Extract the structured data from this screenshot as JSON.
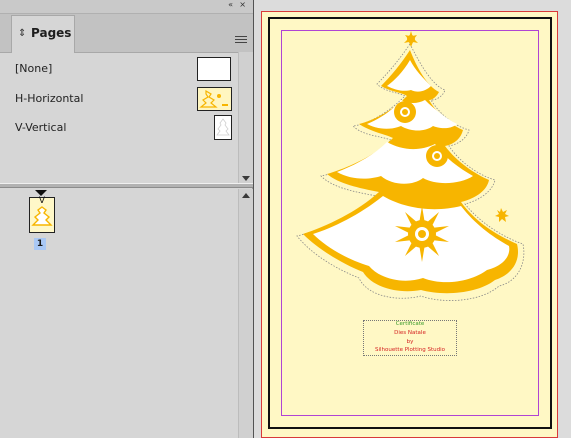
{
  "panel": {
    "tab_label": "Pages",
    "collapse_glyph": "«",
    "close_glyph": "×",
    "tab_arrow_glyph": "⇕",
    "masters": [
      {
        "label": "[None]"
      },
      {
        "label": "H-Horizontal"
      },
      {
        "label": "V-Vertical"
      }
    ],
    "page_thumb_letter": "V",
    "page_number": "1"
  },
  "document": {
    "text_lines": [
      "Certificate",
      "Dies Natale",
      "by",
      "Silhouette Plotting Studio"
    ],
    "colors": {
      "page_fill": "#fff8c5",
      "tree_gold": "#f7b500",
      "margin_guide": "#b044d4",
      "bleed_line": "#d83a3a",
      "text_green": "#3a9a2a",
      "text_red": "#d42020"
    }
  }
}
